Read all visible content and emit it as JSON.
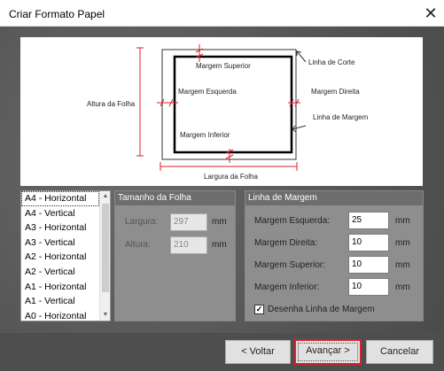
{
  "window": {
    "title": "Criar Formato Papel",
    "close_glyph": "✕"
  },
  "preview": {
    "labels": {
      "height": "Altura da Folha",
      "width": "Largura da Folha",
      "cut_line": "Linha de Corte",
      "margin_line": "Linha de Margem",
      "margin_top": "Margem Superior",
      "margin_left": "Margem Esquerda",
      "margin_right": "Margem Direita",
      "margin_bottom": "Margem Inferior"
    }
  },
  "size_list": {
    "selected": "A4 - Horizontal",
    "items": [
      "A4 - Horizontal",
      "A4 - Vertical",
      "A3 - Horizontal",
      "A3 - Vertical",
      "A2 - Horizontal",
      "A2 - Vertical",
      "A1 - Horizontal",
      "A1 - Vertical",
      "A0 - Horizontal"
    ]
  },
  "sheet_size": {
    "title": "Tamanho da Folha",
    "width_label": "Largura:",
    "width_value": "297",
    "height_label": "Altura:",
    "height_value": "210",
    "unit": "mm"
  },
  "margins": {
    "title": "Linha de Margem",
    "left_label": "Margem Esquerda:",
    "left_value": "25",
    "right_label": "Margem Direita:",
    "right_value": "10",
    "top_label": "Margem Superior:",
    "top_value": "10",
    "bottom_label": "Margem Inferior:",
    "bottom_value": "10",
    "unit": "mm",
    "draw_label": "Desenha Linha de Margem",
    "draw_checked": true,
    "check_glyph": "✓"
  },
  "buttons": {
    "back": "< Voltar",
    "next": "Avançar >",
    "cancel": "Cancelar"
  },
  "colors": {
    "focus_border": "#d9202a",
    "group_header": "#6d6d6d"
  }
}
